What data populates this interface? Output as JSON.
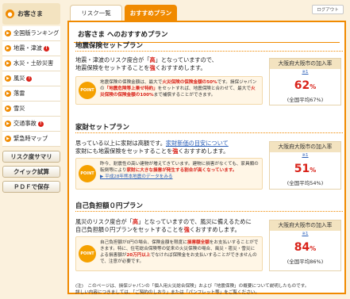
{
  "sidebar": {
    "header": "お客さま",
    "items": [
      {
        "label": "全国版ランキング",
        "badge": ""
      },
      {
        "label": "地震・津波",
        "badge": "!"
      },
      {
        "label": "水災・土砂災害",
        "badge": ""
      },
      {
        "label": "風災",
        "badge": "!"
      },
      {
        "label": "落雷",
        "badge": ""
      },
      {
        "label": "雪災",
        "badge": ""
      },
      {
        "label": "交通事故",
        "badge": "!"
      },
      {
        "label": "緊急時マップ",
        "badge": ""
      }
    ],
    "buttons": [
      "リスク度サマリ",
      "クイック試算",
      "ＰＤＦで保存"
    ]
  },
  "tabs": [
    {
      "label": "リスク一覧",
      "active": false
    },
    {
      "label": "おすすめプラン",
      "active": true
    }
  ],
  "logout_label": "ログアウト",
  "page_title": "お客さま へのおすすめプラン",
  "sections": [
    {
      "title": "地震保険セットプラン",
      "desc": [
        "地震・津波のリスク度合が「",
        "高",
        "」となっていますので、",
        "地震保険をセットすることを",
        "強",
        "くおすすめします。"
      ],
      "point_tag": "POINT",
      "point": [
        "地震保険の保険金額は、最大で",
        "火災保険の保険金額の50%",
        "です。損保ジャパンの",
        "「地震危険等上乗せ特約」",
        "をセットすれば、地震保険と合わせて、最大で",
        "火災保険の保険金額の100%",
        "まで補償することができます。"
      ],
      "rate_head": "大阪府大阪市の加入率",
      "rate_note": "※1",
      "rate_value": "62",
      "rate_unit": "%",
      "rate_avg": "(全国平均67%)"
    },
    {
      "title": "家財セットプラン",
      "desc": [
        "思っている以上に家財は高額です。",
        "家財新価の目安について",
        "家財にも地震保険をセットすることを",
        "強",
        "くおすすめします。"
      ],
      "point_tag": "POINT",
      "point": [
        "昨今、耐震性の高い建物が増えてきています。建物に損害がなくても、家具類の転倒等により",
        "家財に大きな損害が発生する割合が高くなっています。",
        "",
        "平成28年熊本地震のデータをみる"
      ],
      "rate_head": "大阪府大阪市の加入率",
      "rate_note": "※1",
      "rate_value": "51",
      "rate_unit": "%",
      "rate_avg": "(全国平均54%)"
    },
    {
      "title": "自己負担額０円プラン",
      "desc": [
        "風災のリスク度合が「",
        "高",
        "」となっていますので、風災に備えるために",
        "自己負担額０円プランをセットすることを",
        "強",
        "くおすすめします。"
      ],
      "point_tag": "POINT",
      "point": [
        "自己負担額が0円の場合、保険金額を限度に",
        "損害額全額",
        "をお支払いすることができます。特に、住宅総合保険等の従来の火災保険の場合、風災・雹災・雪災による損害額が",
        "20万円以上",
        "でなければ保険金をお支払いすることができませんので、注意が必要です。"
      ],
      "rate_head": "大阪府大阪市の加入率",
      "rate_note": "※1",
      "rate_value": "84",
      "rate_unit": "%",
      "rate_avg": "(全国平均86%)"
    }
  ],
  "footnote": [
    "(注)　このページは、損保ジャパンの「個人用火災総合保険」および「地震保険」の概要について説明したものです。",
    "詳しい内容につきましては、「ご契約のしおり」または「パンフレット等」をご覧ください。"
  ],
  "colors": {
    "accent": "#f08a00",
    "alert": "#d9231a",
    "link": "#2b5fb8",
    "background": "#fbf1dd"
  }
}
